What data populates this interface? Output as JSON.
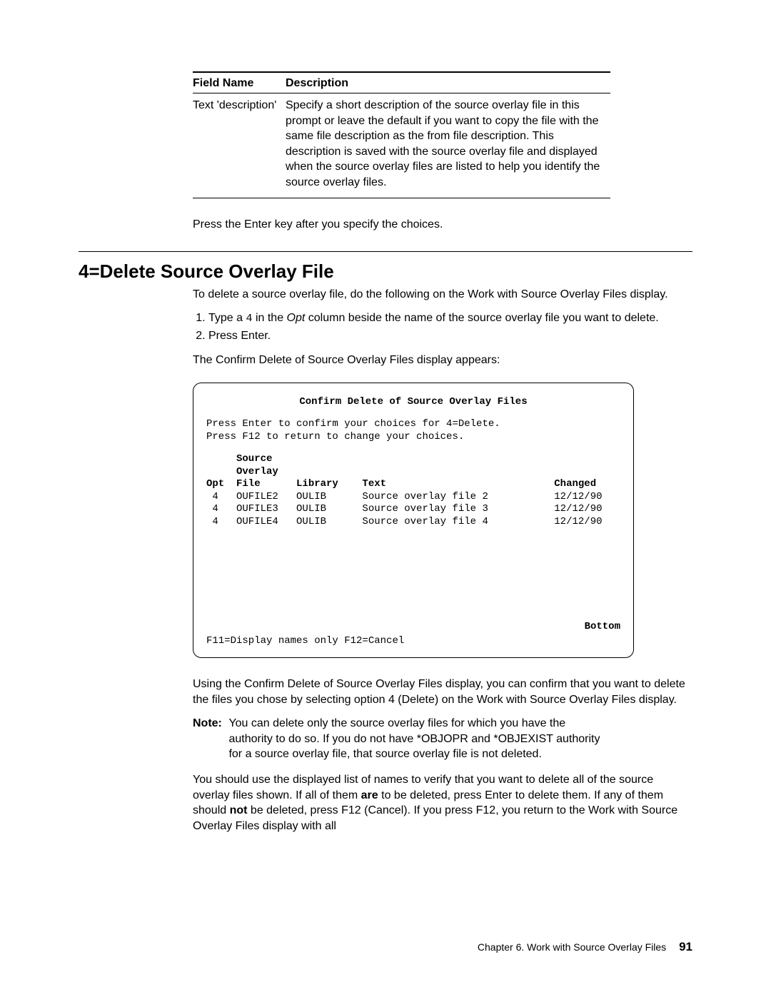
{
  "table": {
    "header": {
      "col1": "Field Name",
      "col2": "Description"
    },
    "row": {
      "field": "Text 'description'",
      "desc": "Specify a short description of the source overlay file in this prompt or leave the default if you want to copy the file with the same file description as the from file description.  This description is saved with the source overlay file and displayed when the source overlay files are listed to help you identify the source overlay files."
    }
  },
  "after_table": "Press the Enter key after you specify the choices.",
  "heading": "4=Delete Source Overlay File",
  "intro": "To delete a source overlay file, do the following on the Work with Source Overlay Files display.",
  "steps": {
    "s1a": "Type a ",
    "s1b": "4",
    "s1c": " in the ",
    "s1d": "Opt",
    "s1e": " column beside the name of the source overlay file you want to delete.",
    "s2": "Press Enter."
  },
  "pre_screen": "The Confirm Delete of Source Overlay Files display appears:",
  "screen": {
    "title": "Confirm Delete of Source Overlay Files",
    "msg1": "Press Enter to confirm your choices for 4=Delete.",
    "msg2": "Press F12 to return to change your choices.",
    "col_hdr1": "     Source",
    "col_hdr2": "     Overlay",
    "col_hdr3": "Opt  File      Library    Text                            Changed",
    "rows": [
      " 4   OUFILE2   OULIB      Source overlay file 2           12/12/90",
      " 4   OUFILE3   OULIB      Source overlay file 3           12/12/90",
      " 4   OUFILE4   OULIB      Source overlay file 4           12/12/90"
    ],
    "bottom": "Bottom",
    "fkeys": "F11=Display names only   F12=Cancel"
  },
  "para_after1": "Using the Confirm Delete of Source Overlay Files display, you can confirm that you want to delete the files you chose by selecting option 4 (Delete) on the Work with Source Overlay Files display.",
  "note": {
    "label": "Note:",
    "body": "You can delete only the source overlay files for which you have the authority to do so.  If you do not have *OBJOPR and *OBJEXIST authority for a source overlay file, that source overlay file is not deleted."
  },
  "para_after2_a": "You should use the displayed list of names to verify that you want to delete all of the source overlay files shown.  If all of them ",
  "para_after2_b": "are",
  "para_after2_c": " to be deleted, press Enter to delete them.  If any of them should ",
  "para_after2_d": "not",
  "para_after2_e": " be deleted, press F12 (Cancel).  If you press F12, you return to the Work with Source Overlay Files display with all",
  "footer": {
    "chapter": "Chapter 6.  Work with Source Overlay Files",
    "page": "91"
  }
}
